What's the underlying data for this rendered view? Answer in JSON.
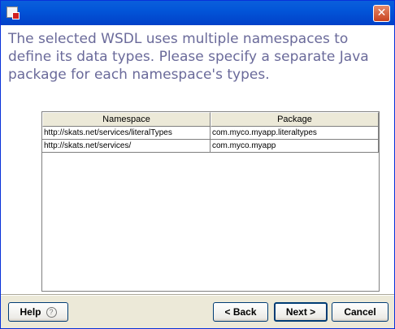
{
  "window": {
    "close_glyph": "✕"
  },
  "message": "The selected WSDL uses multiple namespaces to define its data types.  Please specify a separate Java package for each namespace's types.",
  "table": {
    "columns": [
      "Namespace",
      "Package"
    ],
    "rows": [
      {
        "namespace": "http://skats.net/services/literalTypes",
        "package": "com.myco.myapp.literaltypes"
      },
      {
        "namespace": "http://skats.net/services/",
        "package": "com.myco.myapp"
      }
    ]
  },
  "buttons": {
    "help": "Help",
    "help_icon_glyph": "?",
    "back": "< Back",
    "next": "Next >",
    "cancel": "Cancel"
  }
}
